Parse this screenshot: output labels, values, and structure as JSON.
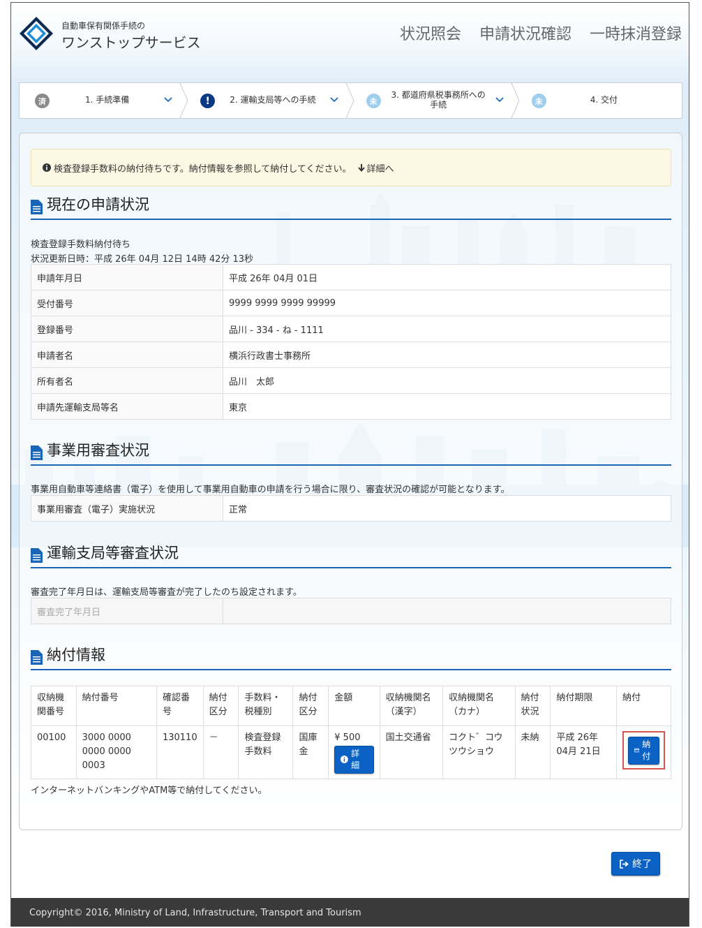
{
  "header": {
    "brand_small": "自動車保有関係手続の",
    "brand_large": "ワンストップサービス",
    "nav": [
      "状況照会",
      "申請状況確認",
      "一時抹消登録"
    ]
  },
  "steps": [
    {
      "badge": "済",
      "label": "1. 手続準備"
    },
    {
      "badge": "!",
      "label": "2. 運輸支局等への手続"
    },
    {
      "badge": "未",
      "label": "3. 都道府県税事務所への手続"
    },
    {
      "badge": "未",
      "label": "4. 交付"
    }
  ],
  "alert": {
    "text": "検査登録手数料の納付待ちです。納付情報を参照して納付してください。",
    "link": "詳細へ"
  },
  "current": {
    "title": "現在の申請状況",
    "status": "検査登録手数料納付待ち",
    "updated": "状況更新日時：平成 26年 04月 12日 14時 42分 13秒",
    "rows": [
      {
        "k": "申請年月日",
        "v": "平成 26年 04月 01日"
      },
      {
        "k": "受付番号",
        "v": "9999 9999 9999 99999"
      },
      {
        "k": "登録番号",
        "v": "品川 - 334 - ね - 1111"
      },
      {
        "k": "申請者名",
        "v": "横浜行政書士事務所"
      },
      {
        "k": "所有者名",
        "v": "品川　太郎"
      },
      {
        "k": "申請先運輸支局等名",
        "v": "東京"
      }
    ]
  },
  "business": {
    "title": "事業用審査状況",
    "note": "事業用自動車等連絡書（電子）を使用して事業用自動車の申請を行う場合に限り、審査状況の確認が可能となります。",
    "row": {
      "k": "事業用審査（電子）実施状況",
      "v": "正常"
    }
  },
  "transport": {
    "title": "運輸支局等審査状況",
    "note": "審査完了年月日は、運輸支局等審査が完了したのち設定されます。",
    "row": {
      "k": "審査完了年月日",
      "v": ""
    }
  },
  "payment": {
    "title": "納付情報",
    "headers": [
      "収納機関番号",
      "納付番号",
      "確認番号",
      "納付区分",
      "手数料・税種別",
      "納付区分",
      "金額",
      "収納機関名（漢字）",
      "収納機関名（カナ）",
      "納付状況",
      "納付期限",
      "納付"
    ],
    "row": {
      "org_no": "00100",
      "pay_no": "3000 0000 0000 0000 0003",
      "confirm_no": "130110",
      "pay_kbn": "－",
      "fee_type": "検査登録手数料",
      "pay_cat": "国庫金",
      "amount": "¥ 500",
      "detail_label": "詳細",
      "org_kanji": "国土交通省",
      "org_kana": "コクト゛コウツウショウ",
      "status": "未納",
      "deadline": "平成 26年 04月 21日",
      "pay_label": "納付"
    },
    "footnote": "インターネットバンキングやATM等で納付してください。"
  },
  "end_label": "終了",
  "copyright": "Copyright© 2016, Ministry of Land, Infrastructure, Transport and Tourism",
  "colors": {
    "primary": "#0b62c4",
    "section_line": "#1a65b6",
    "alert_bg": "#fcf8e3",
    "footer_bg": "#3a3a3a",
    "highlight": "#d9534f"
  }
}
